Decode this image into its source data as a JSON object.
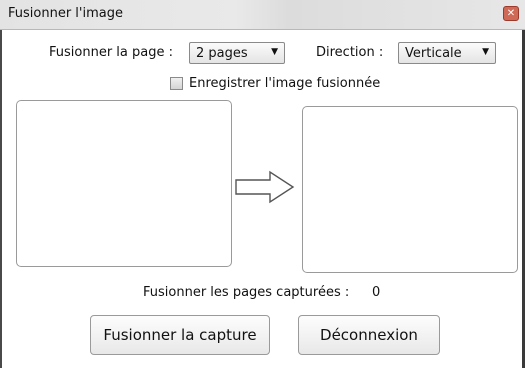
{
  "window": {
    "title": "Fusionner l'image"
  },
  "controls": {
    "merge_page_label": "Fusionner la page :",
    "merge_page_value": "2 pages",
    "direction_label": "Direction :",
    "direction_value": "Verticale",
    "save_checkbox_label": "Enregistrer l'image fusionnée",
    "save_checked": false
  },
  "status": {
    "captured_label": "Fusionner les pages capturées :",
    "captured_count": "0"
  },
  "buttons": {
    "merge_capture": "Fusionner la capture",
    "disconnect": "Déconnexion"
  },
  "icons": {
    "close": "close-icon",
    "arrow": "right-arrow-icon",
    "dropdown": "chevron-down-icon"
  }
}
